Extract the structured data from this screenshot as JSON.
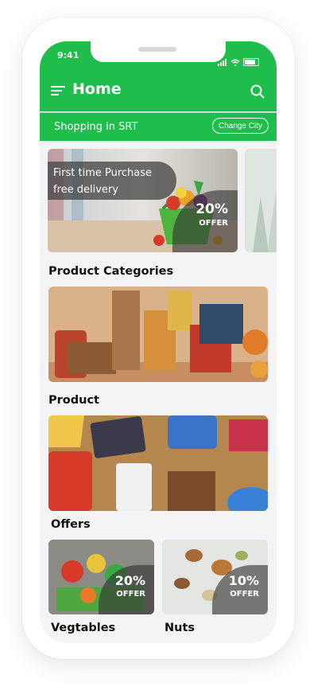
{
  "status": {
    "time": "9:41"
  },
  "header": {
    "title": "Home",
    "menu_icon": "hamburger-menu-icon",
    "search_icon": "search-icon"
  },
  "city_bar": {
    "text": "Shopping in SRT",
    "button": "Change City"
  },
  "banner": {
    "line1": "First time Purchase",
    "line2": "free delivery",
    "offer_percent": "20%",
    "offer_label": "OFFER"
  },
  "sections": {
    "categories": "Product Categories",
    "product": "Product",
    "offers": "Offers"
  },
  "offers": [
    {
      "title": "Vegtables",
      "percent": "20%",
      "label": "OFFER"
    },
    {
      "title": "Nuts",
      "percent": "10%",
      "label": "OFFER"
    }
  ],
  "colors": {
    "brand_green": "#1ebd4c"
  }
}
